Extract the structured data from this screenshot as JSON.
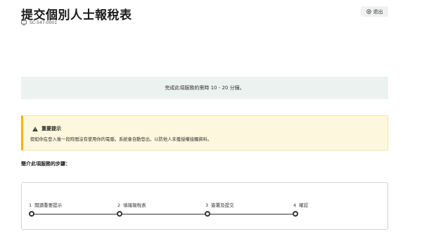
{
  "header": {
    "title": "提交個別人士報稅表",
    "ref_code": "SC-547-0001",
    "logout_label": "退出"
  },
  "info": {
    "text": "完成此項服務約需時 10 - 20 分鐘。"
  },
  "notice": {
    "title": "重要提示",
    "body": "假如你在登入後一段時間沒有使用你的電腦，系統會自動登出，以防他人未獲授權接觸資料。"
  },
  "steps_intro": "簡介此項服務的步驟：",
  "steps": [
    {
      "num": "1",
      "label": "閱讀重要提示"
    },
    {
      "num": "2",
      "label": "填報報稅表"
    },
    {
      "num": "3",
      "label": "簽署及提交"
    },
    {
      "num": "4",
      "label": "確認"
    }
  ],
  "colors": {
    "info_bg": "#ecf2ef",
    "warning_bg": "#fdf8dd",
    "warning_accent": "#f5b400"
  }
}
